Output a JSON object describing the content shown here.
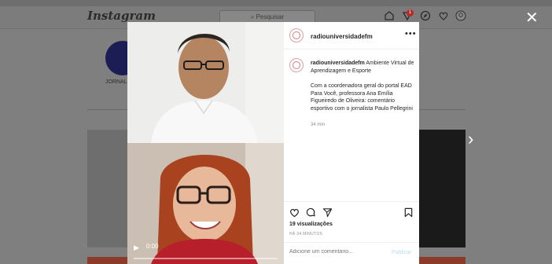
{
  "background": {
    "logo": "Instagram",
    "search_placeholder": "Pesquisar",
    "notification_count": "1",
    "profile_label": "JORNALI"
  },
  "modal": {
    "video": {
      "time": "0:00",
      "progress": 0.0
    },
    "username": "radiouniversidadefm",
    "caption_title": "Ambiente Virtual de Aprendizagem e Esporte",
    "caption_body": "Com a coordenadora geral do portal EAD Para Você, professora Ana Emília Figueiredo de Oliveira: comentário esportivo com o jornalista Paulo Pellegrini",
    "caption_time": "34 min",
    "views": "19 visualizações",
    "time_ago": "HÁ 34 MINUTOS",
    "comment_placeholder": "Adicione um comentário...",
    "publish_label": "Publicar"
  }
}
